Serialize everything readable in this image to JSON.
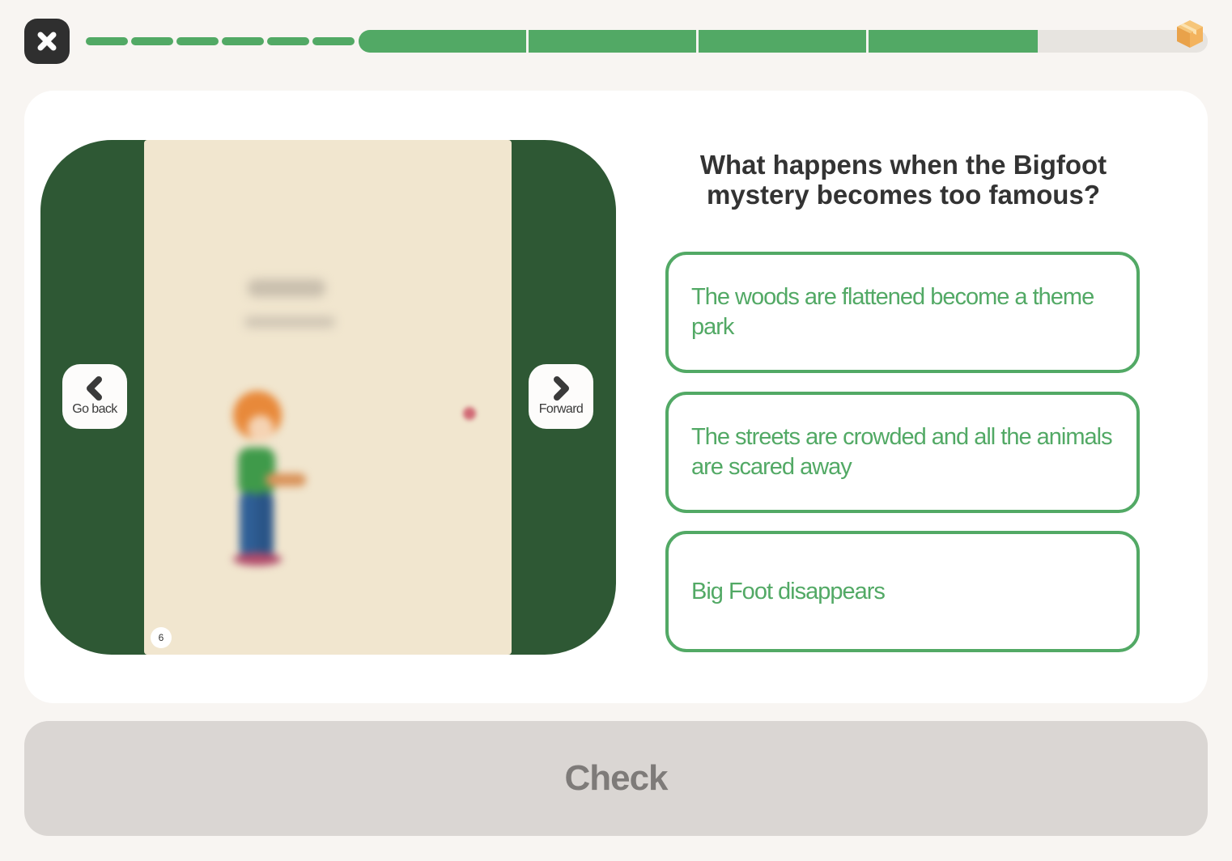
{
  "header": {
    "close_icon": "close-x-icon",
    "progress": {
      "completed_dashes": 6,
      "segments_total": 5,
      "segments_completed": 4,
      "fill_color": "#52a965",
      "track_color": "#e7e4e0"
    },
    "reward_icon": "package-box-icon"
  },
  "book": {
    "page_number": "6",
    "back_label": "Go back",
    "forward_label": "Forward",
    "back_icon": "chevron-left-icon",
    "forward_icon": "chevron-right-icon",
    "frame_color": "#2e5834"
  },
  "quiz": {
    "question": "What happens when the Bigfoot mystery becomes too famous?",
    "answers": [
      "The woods are flattened become a theme park",
      "The streets are crowded and all the animals are scared away",
      "Big Foot disappears"
    ],
    "accent_color": "#52a965"
  },
  "footer": {
    "check_label": "Check"
  }
}
